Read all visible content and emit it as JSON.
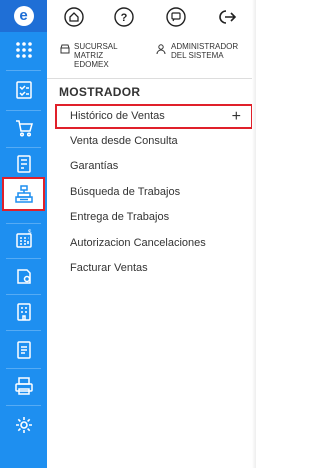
{
  "rail": {
    "logo": "e",
    "items": [
      {
        "icon": "apps-grid-icon"
      },
      {
        "icon": "checklist-icon"
      },
      {
        "icon": "cart-icon"
      },
      {
        "icon": "register-icon"
      },
      {
        "icon": "cashier-icon",
        "active": true
      },
      {
        "icon": "calculator-icon"
      },
      {
        "icon": "box-icon"
      },
      {
        "icon": "building-icon"
      },
      {
        "icon": "document-icon"
      },
      {
        "icon": "printer-icon"
      },
      {
        "icon": "settings-gear-icon"
      }
    ]
  },
  "topbar": {
    "icons": [
      "home-icon",
      "help-icon",
      "chat-icon",
      "logout-icon"
    ]
  },
  "info": {
    "branch_line1": "SUCURSAL",
    "branch_line2": "MATRIZ",
    "branch_line3": "EDOMEX",
    "user_line1": "ADMINISTRADOR",
    "user_line2": "DEL SISTEMA"
  },
  "section_title": "MOSTRADOR",
  "menu": [
    {
      "label": "Histórico de Ventas",
      "selected": true,
      "action": "+"
    },
    {
      "label": "Venta desde Consulta"
    },
    {
      "label": "Garantías"
    },
    {
      "label": "Búsqueda de Trabajos"
    },
    {
      "label": "Entrega de Trabajos"
    },
    {
      "label": "Autorizacion Cancelaciones"
    },
    {
      "label": "Facturar Ventas"
    }
  ],
  "colors": {
    "rail": "#1e8ff0",
    "logo_bg": "#1f6fd6",
    "highlight": "#e0202a"
  }
}
